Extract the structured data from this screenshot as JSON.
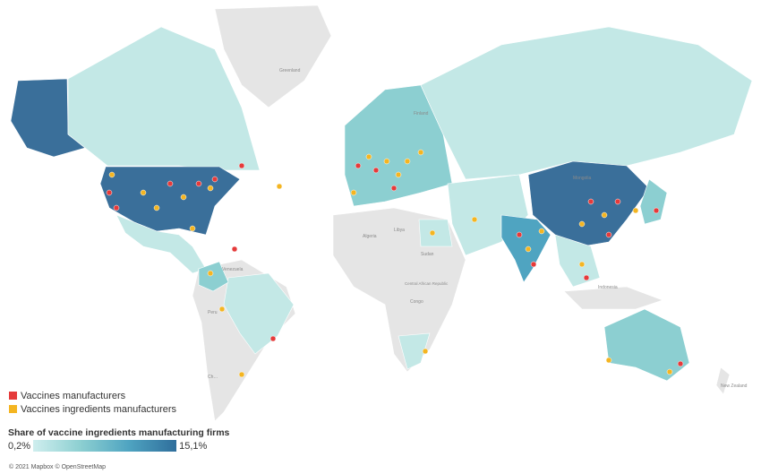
{
  "legend": {
    "categories": [
      {
        "label": "Vaccines manufacturers",
        "color": "#e53a3a"
      },
      {
        "label": "Vaccines ingredients manufacturers",
        "color": "#f4b521"
      }
    ],
    "scale": {
      "title": "Share of vaccine ingredients manufacturing firms",
      "min_label": "0,2%",
      "max_label": "15,1%"
    }
  },
  "basemap_labels": [
    "Greenland",
    "Finland",
    "Mongolia",
    "Algeria",
    "Libya",
    "Sudan",
    "Venezuela",
    "Peru",
    "Central African Republic",
    "Congo",
    "Indonesia",
    "New Zealand",
    "Ch…"
  ],
  "attribution": "© 2021 Mapbox © OpenStreetMap",
  "colors": {
    "ocean": "#ffffff",
    "no_data": "#e5e5e5",
    "low": "#cfeeee",
    "mid": "#8ccfd1",
    "high": "#2f6e9c"
  }
}
